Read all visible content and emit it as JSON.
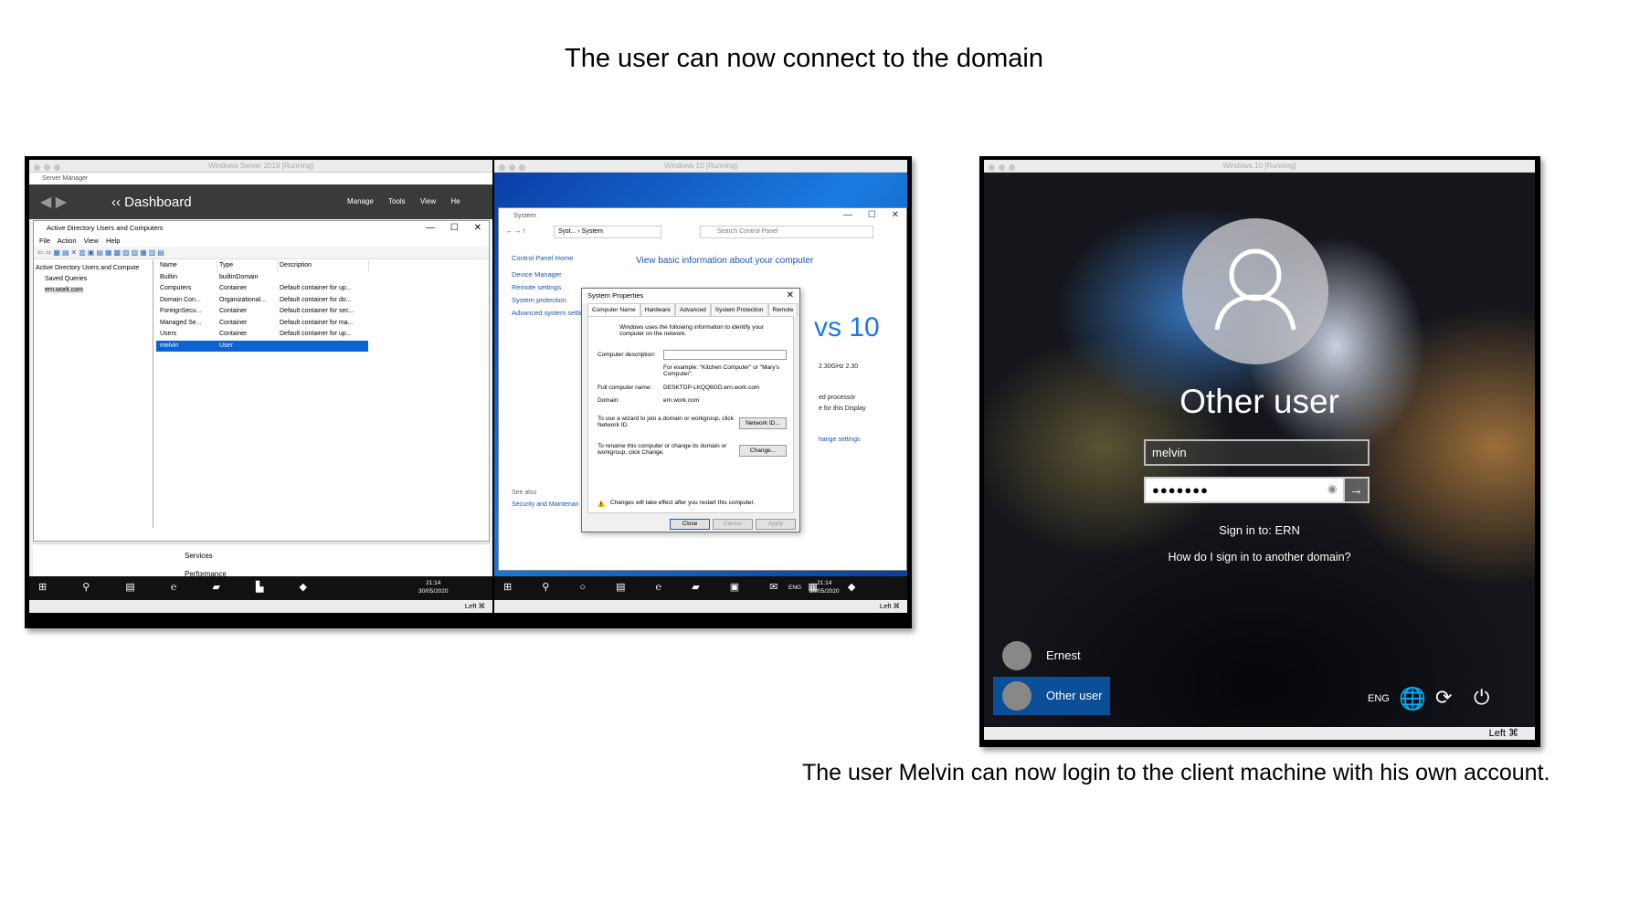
{
  "slide": {
    "title": "The user can now connect to the domain",
    "caption": "The user Melvin can now login to the client machine with his own account."
  },
  "server_vm": {
    "window_title": "Windows Server 2019 [Running]",
    "app_title": "Server Manager",
    "dashboard": "Dashboard",
    "menus": [
      "Manage",
      "Tools",
      "View",
      "He"
    ],
    "aduc": {
      "title": "Active Directory Users and Computers",
      "menu": [
        "File",
        "Action",
        "View",
        "Help"
      ],
      "tree": [
        "Active Directory Users and Compute",
        "Saved Queries",
        "ern.work.com"
      ],
      "columns": [
        "Name",
        "Type",
        "Description"
      ],
      "rows": [
        [
          "Builtin",
          "builtinDomain",
          ""
        ],
        [
          "Computers",
          "Container",
          "Default container for up..."
        ],
        [
          "Domain Con...",
          "Organizational...",
          "Default container for do..."
        ],
        [
          "ForeignSecu...",
          "Container",
          "Default container for sec..."
        ],
        [
          "Managed Se...",
          "Container",
          "Default container for ma..."
        ],
        [
          "Users",
          "Container",
          "Default container for up..."
        ],
        [
          "melvin",
          "User",
          ""
        ]
      ]
    },
    "lower_items": [
      "Services",
      "Performance"
    ],
    "clock_time": "21:14",
    "clock_date": "30/05/2020",
    "status_right": "Left ⌘"
  },
  "client_vm": {
    "window_title": "Windows 10 [Running]",
    "cp_title": "System",
    "breadcrumb": "Syst... › System",
    "search_placeholder": "Search Control Panel",
    "left_links": [
      "Control Panel Home",
      "Device Manager",
      "Remote settings",
      "System protection",
      "Advanced system settin"
    ],
    "heading": "View basic information about your computer",
    "win10_fragment": "vs 10",
    "frag_cpu": "2.30GHz  2.30",
    "frag_proc": "ed processor",
    "frag_display": "e for this Display",
    "frag_change": "hange settings",
    "see_also": "See also",
    "security": "Security and Maintenan",
    "sysprops": {
      "title": "System Properties",
      "tabs": [
        "Computer Name",
        "Hardware",
        "Advanced",
        "System Protection",
        "Remote"
      ],
      "intro": "Windows uses the following information to identify your computer on the network.",
      "desc_label": "Computer description:",
      "example": "For example: \"Kitchen Computer\" or \"Mary's Computer\".",
      "full_name_label": "Full computer name:",
      "full_name_value": "DESKTOP-LKQQ8GD.ern.work.com",
      "domain_label": "Domain:",
      "domain_value": "ern.work.com",
      "wizard_text": "To use a wizard to join a domain or workgroup, click Network ID.",
      "network_id_btn": "Network ID...",
      "rename_text": "To rename this computer or change its domain or workgroup, click Change.",
      "change_btn": "Change...",
      "warning": "Changes will take effect after you restart this computer.",
      "close_btn": "Close",
      "cancel_btn": "Cancel",
      "apply_btn": "Apply"
    },
    "tray_lang": "ENG",
    "clock_time": "21:14",
    "clock_date": "30/05/2020",
    "status_right": "Left ⌘"
  },
  "login_vm": {
    "window_title": "Windows 10 [Running]",
    "heading": "Other user",
    "username_value": "melvin",
    "password_value": "●●●●●●●",
    "sign_in_to": "Sign in to: ERN",
    "other_domain_link": "How do I sign in to another domain?",
    "users": [
      "Ernest",
      "Other user"
    ],
    "lang": "ENG",
    "status_right": "Left ⌘"
  },
  "colors": {
    "selection_blue": "#0a62d3",
    "login_tile_blue": "#0a4f97",
    "link_blue": "#1a55a8"
  }
}
